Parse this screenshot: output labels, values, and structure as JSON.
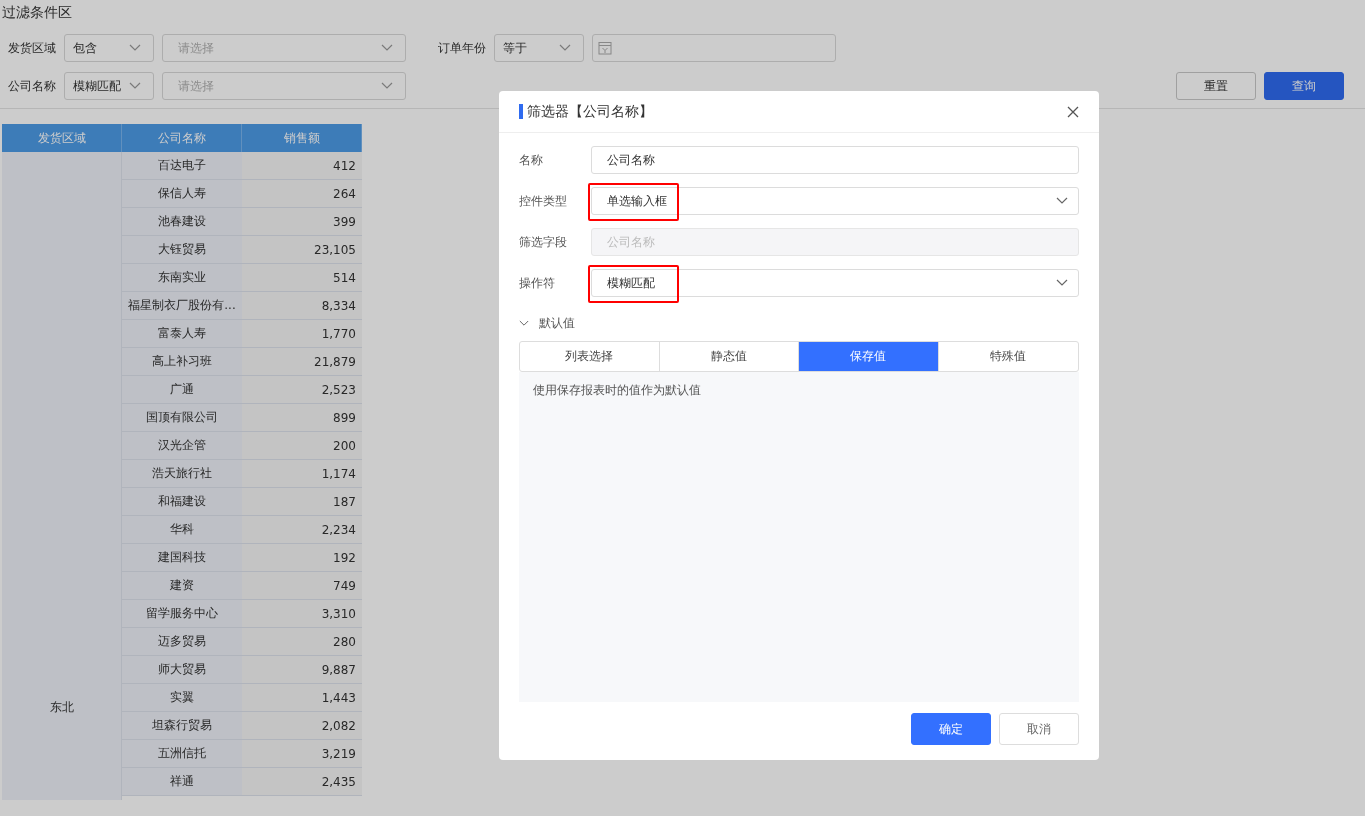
{
  "filter_area": {
    "title": "过滤条件区",
    "filters": [
      {
        "label": "发货区域",
        "operator": "包含",
        "kind": "select",
        "placeholder": "请选择"
      },
      {
        "label": "订单年份",
        "operator": "等于",
        "kind": "date"
      },
      {
        "label": "公司名称",
        "operator": "模糊匹配",
        "kind": "select",
        "placeholder": "请选择"
      }
    ],
    "buttons": [
      {
        "label": "重置",
        "primary": false
      },
      {
        "label": "查询",
        "primary": true
      }
    ]
  },
  "table": {
    "columns": [
      "发货区域",
      "公司名称",
      "销售额"
    ],
    "rows": [
      [
        "",
        "百达电子",
        "412"
      ],
      [
        "",
        "保信人寿",
        "264"
      ],
      [
        "",
        "池春建设",
        "399"
      ],
      [
        "",
        "大钰贸易",
        "23,105"
      ],
      [
        "",
        "东南实业",
        "514"
      ],
      [
        "",
        "福星制衣厂股份有...",
        "8,334"
      ],
      [
        "",
        "富泰人寿",
        "1,770"
      ],
      [
        "",
        "高上补习班",
        "21,879"
      ],
      [
        "",
        "广通",
        "2,523"
      ],
      [
        "",
        "国顶有限公司",
        "899"
      ],
      [
        "",
        "汉光企管",
        "200"
      ],
      [
        "",
        "浩天旅行社",
        "1,174"
      ],
      [
        "",
        "和福建设",
        "187"
      ],
      [
        "",
        "华科",
        "2,234"
      ],
      [
        "",
        "建国科技",
        "192"
      ],
      [
        "",
        "建资",
        "749"
      ],
      [
        "",
        "留学服务中心",
        "3,310"
      ],
      [
        "",
        "迈多贸易",
        "280"
      ],
      [
        "",
        "师大贸易",
        "9,887"
      ],
      [
        "东北",
        "实翼",
        "1,443"
      ],
      [
        "",
        "坦森行贸易",
        "2,082"
      ],
      [
        "",
        "五洲信托",
        "3,219"
      ],
      [
        "",
        "祥通",
        "2,435"
      ]
    ]
  },
  "dialog": {
    "title": "筛选器【公司名称】",
    "fields": [
      {
        "label": "名称",
        "kind": "input",
        "value": "公司名称",
        "highlighted": false
      },
      {
        "label": "控件类型",
        "kind": "select",
        "value": "单选输入框",
        "highlighted": true
      },
      {
        "label": "筛选字段",
        "kind": "disabled",
        "value": "公司名称",
        "highlighted": false
      },
      {
        "label": "操作符",
        "kind": "select",
        "value": "模糊匹配",
        "highlighted": true
      }
    ],
    "section": {
      "label": "默认值",
      "expanded": true
    },
    "tabs": [
      {
        "label": "列表选择",
        "selected": false
      },
      {
        "label": "静态值",
        "selected": false
      },
      {
        "label": "保存值",
        "selected": true
      },
      {
        "label": "特殊值",
        "selected": false
      }
    ],
    "tab_content": "使用保存报表时的值作为默认值",
    "buttons": [
      {
        "label": "确定",
        "primary": true
      },
      {
        "label": "取消",
        "primary": false
      }
    ]
  }
}
